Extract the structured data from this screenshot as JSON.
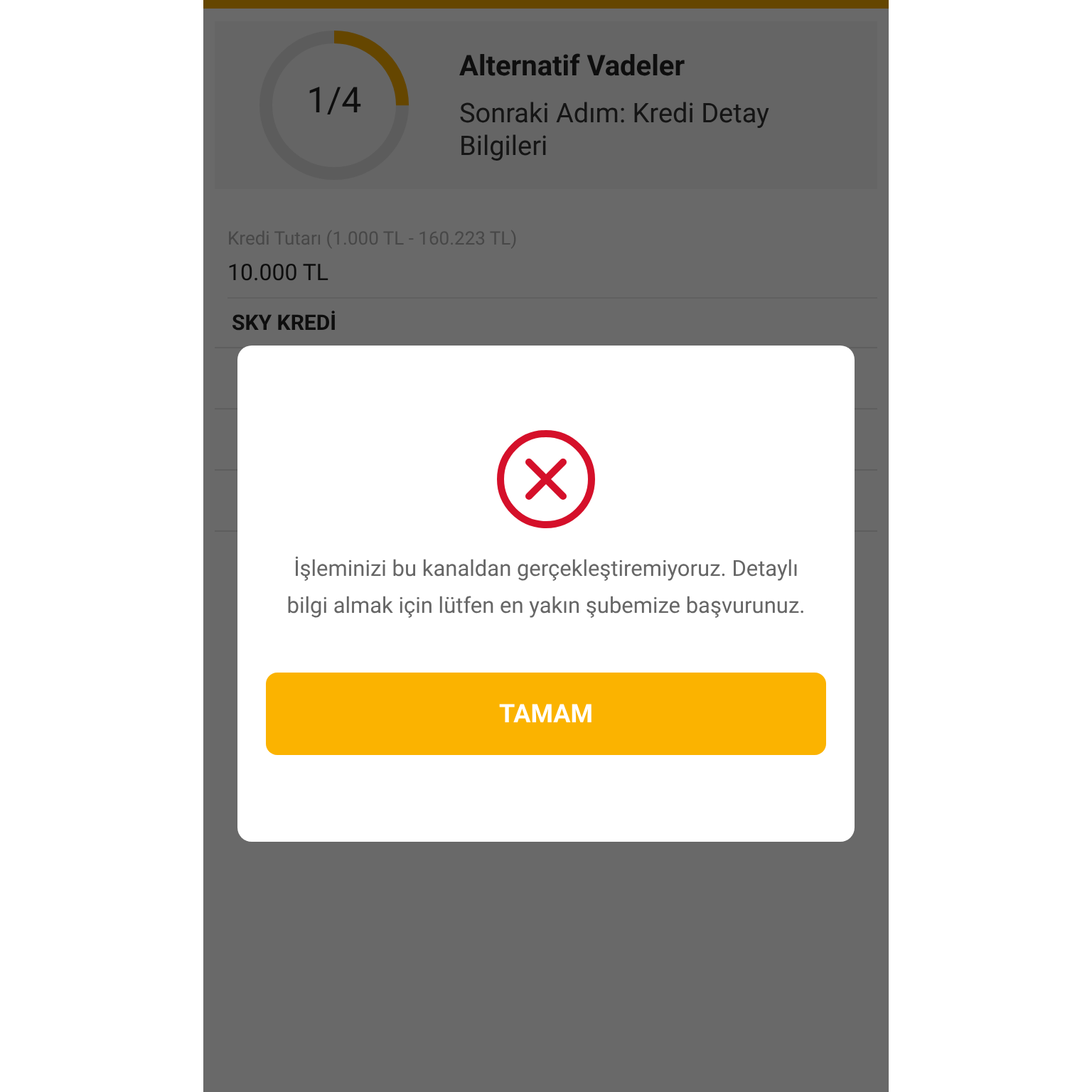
{
  "progress": {
    "step": "1/4",
    "level": 0.25,
    "title": "Alternatif Vadeler",
    "subtitle": "Sonraki Adım: Kredi Detay Bilgileri"
  },
  "amount": {
    "label": "Kredi Tutarı (1.000 TL - 160.223 TL)",
    "value": "10.000 TL"
  },
  "product": "SKY KREDİ",
  "dialog": {
    "message": "İşleminizi bu kanaldan gerçekleştiremiyoruz. Detaylı bilgi almak için lütfen en yakın şubemize başvurunuz.",
    "button": "TAMAM"
  }
}
